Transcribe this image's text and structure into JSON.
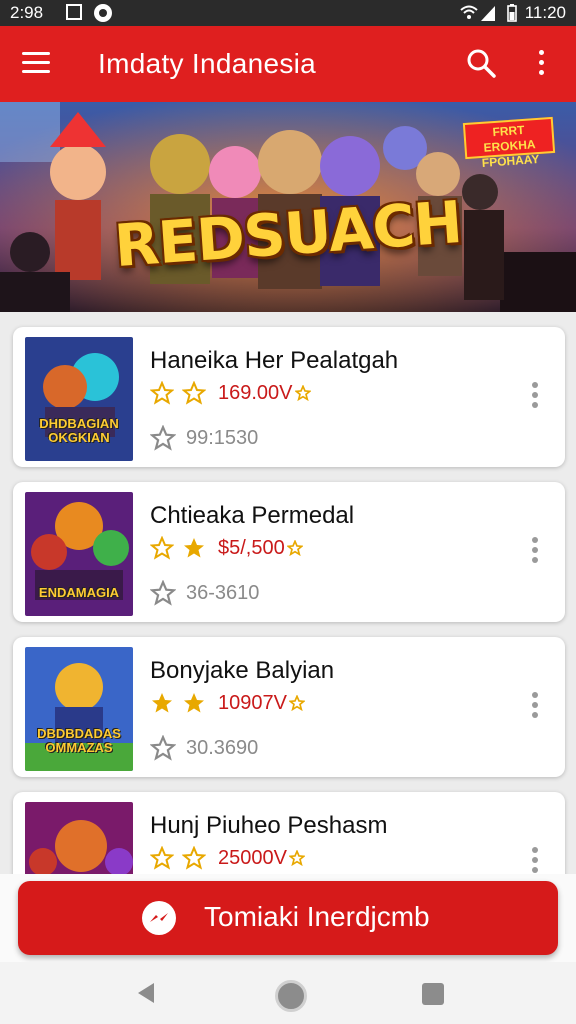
{
  "status_bar": {
    "left_time": "2:98",
    "right_time": "11:20",
    "icons": [
      "image-icon",
      "record-icon",
      "wifi-icon",
      "signal-icon",
      "battery-icon"
    ]
  },
  "app_bar": {
    "title": "Imdaty Indanesia",
    "background": "#df1f1f",
    "icons": [
      "menu-icon",
      "search-icon",
      "more-vert-icon"
    ]
  },
  "banner": {
    "title": "REDSUACH",
    "badge": "FRRT EROKHA FPOHAAY"
  },
  "items": [
    {
      "title": "Haneika Her Pealatgah",
      "thumb_text": "DHDBAGIAN OKGKIAN",
      "stars": [
        "outline",
        "outline"
      ],
      "price": "169.00V",
      "count": "99:1530",
      "thumb_colors": [
        "#2a3f8f",
        "#d8682a",
        "#2ac2d8"
      ]
    },
    {
      "title": "Chtieaka Permedal",
      "thumb_text": "ENDAMAGIA",
      "stars": [
        "outline",
        "filled"
      ],
      "price": "$5/,500",
      "count": "36-3610",
      "thumb_colors": [
        "#5a1f7a",
        "#e88a20",
        "#3fb04a"
      ]
    },
    {
      "title": "Bonyjake Balyian",
      "thumb_text": "DBDBDADAS OMMAZAS",
      "stars": [
        "filled",
        "filled"
      ],
      "price": "10907V",
      "count": "30.3690",
      "thumb_colors": [
        "#3a66c8",
        "#f0b430",
        "#4aa83a"
      ]
    },
    {
      "title": "Hunj Piuheo Peshasm",
      "thumb_text": "",
      "stars": [
        "outline",
        "outline"
      ],
      "price": "25000V",
      "count": "",
      "thumb_colors": [
        "#7a1a6a",
        "#e0702a",
        "#c8382a"
      ]
    }
  ],
  "cta": {
    "label": "Tomiaki Inerdjcmb",
    "icon": "messenger-icon"
  },
  "nav_bar": {
    "icons": [
      "back-icon",
      "home-icon",
      "recents-icon"
    ]
  }
}
